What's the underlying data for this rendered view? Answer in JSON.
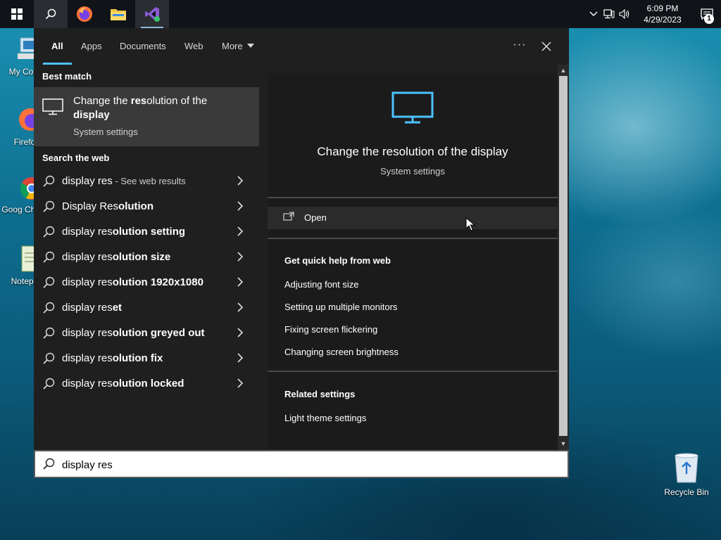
{
  "taskbar": {
    "clock_time": "6:09 PM",
    "clock_date": "4/29/2023",
    "notification_count": "1"
  },
  "desktop": {
    "icons": [
      {
        "label": "My Com"
      },
      {
        "label": "Firefo"
      },
      {
        "label": "Goog Chron"
      },
      {
        "label": "Notepa"
      },
      {
        "label": "Recycle Bin"
      }
    ]
  },
  "search": {
    "tabs": [
      "All",
      "Apps",
      "Documents",
      "Web",
      "More"
    ],
    "active_tab": "All",
    "ellipsis": "···",
    "best_match_header": "Best match",
    "best_match": {
      "title_pre": "Change the ",
      "title_bold": "res",
      "title_post": "olution of the",
      "title_line2": "display",
      "subtitle": "System settings"
    },
    "web_header": "Search the web",
    "web_results": [
      {
        "prefix": "display res",
        "suffix": "",
        "note": " - See web results"
      },
      {
        "prefix": "Display Res",
        "suffix": "olution",
        "note": ""
      },
      {
        "prefix": "display res",
        "suffix": "olution setting",
        "note": ""
      },
      {
        "prefix": "display res",
        "suffix": "olution size",
        "note": ""
      },
      {
        "prefix": "display res",
        "suffix": "olution 1920x1080",
        "note": ""
      },
      {
        "prefix": "display res",
        "suffix": "et",
        "note": ""
      },
      {
        "prefix": "display res",
        "suffix": "olution greyed out",
        "note": ""
      },
      {
        "prefix": "display res",
        "suffix": "olution fix",
        "note": ""
      },
      {
        "prefix": "display res",
        "suffix": "olution locked",
        "note": ""
      }
    ],
    "detail": {
      "title": "Change the resolution of the display",
      "subtitle": "System settings",
      "open_label": "Open",
      "quick_help_header": "Get quick help from web",
      "quick_help_links": [
        "Adjusting font size",
        "Setting up multiple monitors",
        "Fixing screen flickering",
        "Changing screen brightness"
      ],
      "related_header": "Related settings",
      "related_links": [
        "Light theme settings"
      ]
    },
    "query": "display res",
    "accent_color": "#4cc2ff"
  }
}
